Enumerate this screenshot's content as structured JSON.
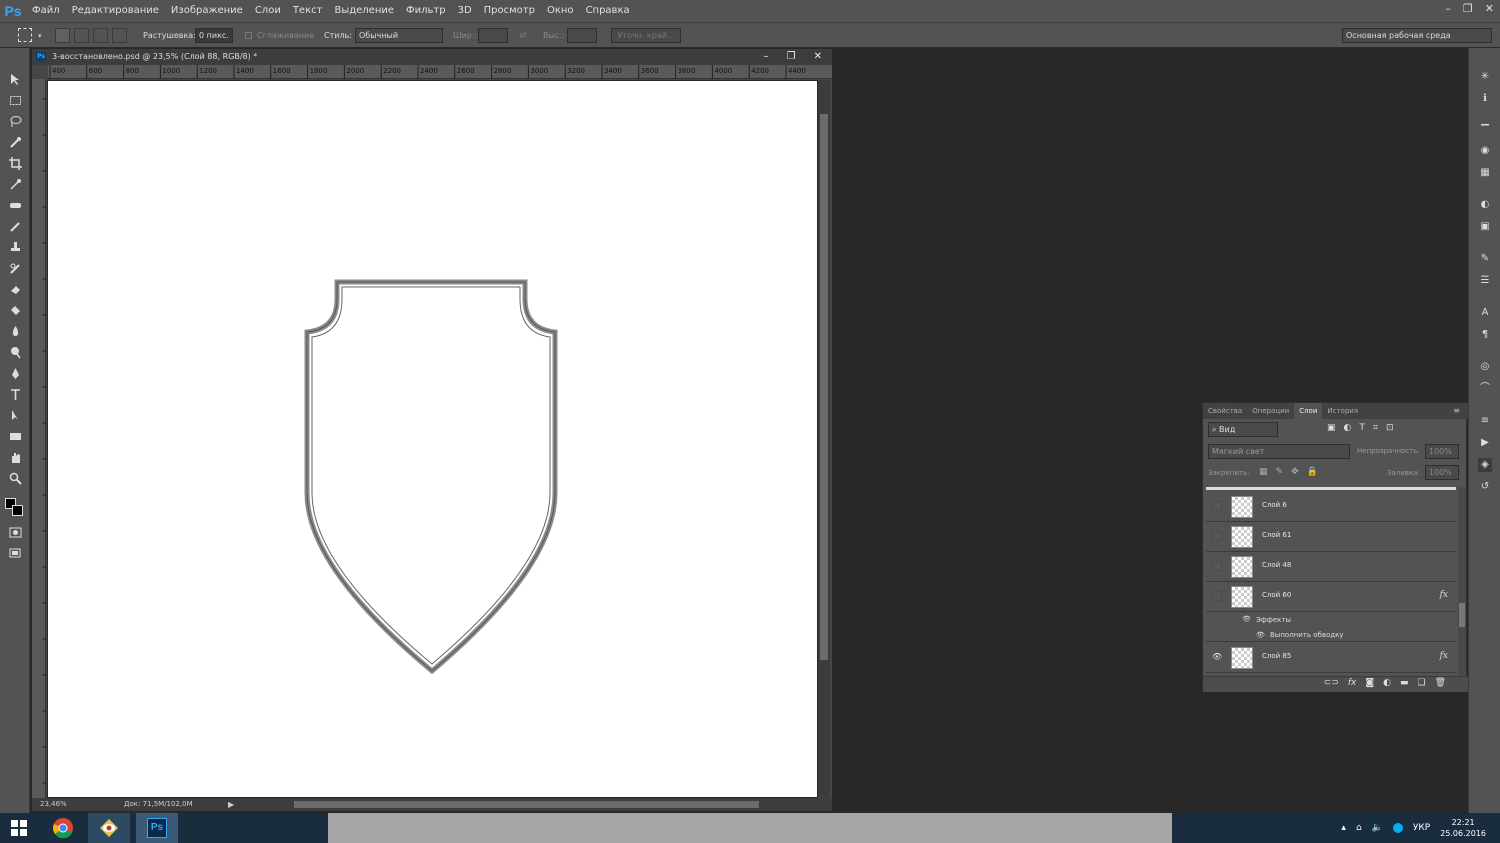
{
  "app": {
    "logo": "Ps"
  },
  "menu": [
    "Файл",
    "Редактирование",
    "Изображение",
    "Слои",
    "Текст",
    "Выделение",
    "Фильтр",
    "3D",
    "Просмотр",
    "Окно",
    "Справка"
  ],
  "window_controls": {
    "minimize": "–",
    "restore": "❐",
    "close": "✕"
  },
  "options": {
    "feather_label": "Растушевка:",
    "feather_value": "0 пикс.",
    "antialias_label": "Сглаживание",
    "style_label": "Стиль:",
    "style_value": "Обычный",
    "width_label": "Шир.:",
    "height_label": "Выс.:",
    "refine_button": "Уточн. край...",
    "workspace": "Основная рабочая среда"
  },
  "document": {
    "title": "3-восстановлено.psd @ 23,5% (Слой 88, RGB/8) *",
    "zoom": "23,46%",
    "doc_info": "Док: 71,5M/102,0M",
    "ruler_marks": [
      "400",
      "600",
      "800",
      "1000",
      "1200",
      "1400",
      "1600",
      "1800",
      "2000",
      "2200",
      "2400",
      "2600",
      "2800",
      "3000",
      "3200",
      "3400",
      "3600",
      "3800",
      "4000",
      "4200",
      "4400"
    ]
  },
  "layers_panel": {
    "tabs": [
      "Свойства",
      "Операции",
      "Слои",
      "История"
    ],
    "active_tab": "Слои",
    "filter_label": "Вид",
    "blend_mode": "Мягкий свет",
    "opacity_label": "Непрозрачность:",
    "opacity_value": "100%",
    "lock_label": "Закрепить:",
    "fill_label": "Заливка:",
    "fill_value": "100%",
    "layers": [
      {
        "name": "Слой 6",
        "visible": false,
        "fx": ""
      },
      {
        "name": "Слой 61",
        "visible": false,
        "fx": ""
      },
      {
        "name": "Слой 48",
        "visible": false,
        "fx": ""
      },
      {
        "name": "Слой 60",
        "visible": false,
        "fx": "fx"
      },
      {
        "name": "Слой 85",
        "visible": true,
        "fx": "fx"
      }
    ],
    "effects_label": "Эффекты",
    "stroke_label": "Выполнить обводку"
  },
  "taskbar": {
    "lang": "УКР",
    "time": "22:21",
    "date": "25.06.2016"
  },
  "colors": {
    "accent": "#31a8ff",
    "panel": "#535353",
    "canvas": "#ffffff"
  }
}
